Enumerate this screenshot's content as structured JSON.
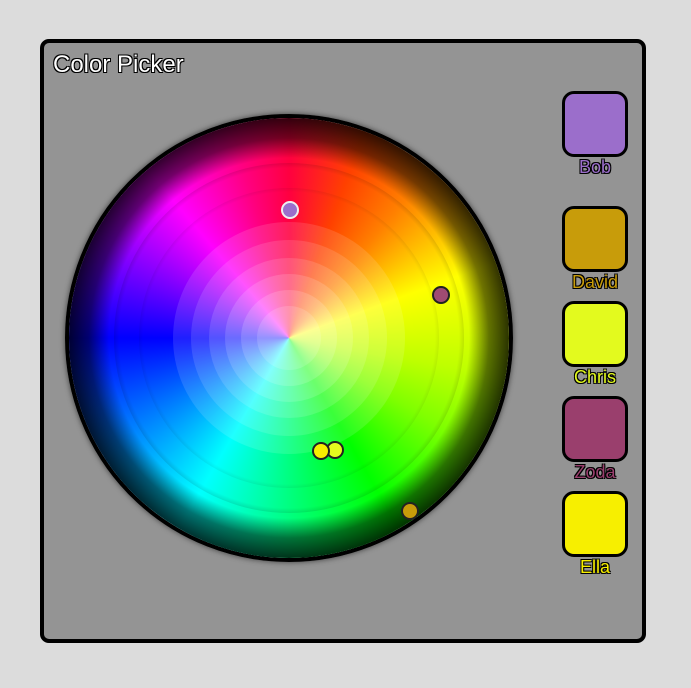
{
  "window": {
    "title": "Color Picker"
  },
  "wheel": {
    "markers": [
      {
        "user": "Bob",
        "color": "#9b6ecb",
        "light_border": true
      },
      {
        "user": "Zoda",
        "color": "#a04b72",
        "light_border": false
      },
      {
        "user": "Chris",
        "color": "#e3fa1e",
        "light_border": false
      },
      {
        "user": "Ella",
        "color": "#f7ef00",
        "light_border": false
      },
      {
        "user": "David",
        "color": "#c89c0a",
        "light_border": false
      }
    ]
  },
  "users": [
    {
      "name": "Bob",
      "color": "#9b6ecb"
    },
    {
      "name": "David",
      "color": "#c89c0a"
    },
    {
      "name": "Chris",
      "color": "#e3fa1e"
    },
    {
      "name": "Zoda",
      "color": "#9a3f6d"
    },
    {
      "name": "Ella",
      "color": "#f7ef00"
    }
  ]
}
